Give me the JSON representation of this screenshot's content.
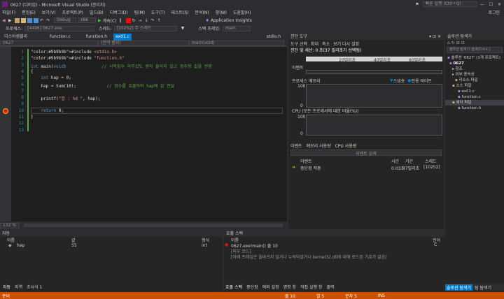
{
  "window": {
    "title": "0627 (디버깅) - Microsoft Visual Studio (관리자)",
    "quick_launch": "빠른 실행 (Ctrl+Q)",
    "login": "로그인"
  },
  "menu": [
    "파일(F)",
    "편집(E)",
    "보기(V)",
    "프로젝트(P)",
    "빌드(B)",
    "디버그(D)",
    "팀(M)",
    "도구(T)",
    "테스트(S)",
    "분석(N)",
    "창(W)",
    "도움말(H)"
  ],
  "toolbar": {
    "config": "Debug",
    "platform": "x86",
    "continue": "계속(C)",
    "app_insights": "Application Insights"
  },
  "debugbar": {
    "process_label": "프로세스:",
    "process": "[4496] 0627.exe",
    "thread_label": "스레드:",
    "thread": "[10252] 주 스레드",
    "frame_label": "스택 프레임:",
    "frame": "main"
  },
  "editor": {
    "tabs": [
      "디스어셈블리",
      "function.c",
      "function.h",
      "ex01.c"
    ],
    "active_tab": "ex01.c",
    "right_tab": "stdio.h",
    "nav_project": "0627",
    "nav_scope": "(전역 범위)",
    "nav_func": "main(void)",
    "zoom": "132 %"
  },
  "code": [
    {
      "n": "1",
      "t": "#include <stdio.h>"
    },
    {
      "n": "2",
      "t": "#include \"function.h\""
    },
    {
      "n": "3",
      "t": "int main(void)              // 시작함수 아무것도 받아 들이지 않고 정수형 값을 반환"
    },
    {
      "n": "4",
      "t": "{"
    },
    {
      "n": "5",
      "t": "    int hap = 0;"
    },
    {
      "n": "6",
      "t": "    hap = Sum(10);            // 함수를 호출하여 hap에 값 전달"
    },
    {
      "n": "7",
      "t": ""
    },
    {
      "n": "8",
      "t": "    printf(\"합 : %d \", hap);"
    },
    {
      "n": "9",
      "t": ""
    },
    {
      "n": "10",
      "t": "    return 0;"
    },
    {
      "n": "11",
      "t": "}"
    },
    {
      "n": "12",
      "t": ""
    },
    {
      "n": "13",
      "t": ""
    }
  ],
  "diag": {
    "title": "진단 도구",
    "session": "진단 및 세션: 0 초(37 밀리초가 선택됨)",
    "ticks": [
      "20밀리초",
      "40밀리초",
      "60밀리초"
    ],
    "events": "이벤트",
    "memory": "프로세스 메모리",
    "snapshot": "스냅숏",
    "private": "전용 바이트",
    "mem_max": "100",
    "mem_min": "0",
    "cpu": "CPU (모든 프로세서에 대한 비율(%))",
    "cpu_max": "100",
    "cpu_min": "0",
    "tabs": [
      "이벤트",
      "메모리 사용량",
      "CPU 사용량"
    ],
    "search": "이벤트 검색",
    "cols": [
      "이벤트",
      "시간",
      "기간",
      "스레드"
    ],
    "row": {
      "event": "중단점 적중",
      "time": "0.03초",
      "duration": "37밀리초",
      "thread": "[10252]"
    },
    "buttons": [
      "도구 선택",
      "확대",
      "축소",
      "보기 다시 설정"
    ]
  },
  "solution": {
    "title": "솔루션 탐색기",
    "search": "솔루션 탐색기 검색(Ctrl+;)",
    "items": [
      "솔루션 '0627' (1개 프로젝트)",
      "0627",
      "참조",
      "외부 종속성",
      "리소스 파일",
      "소스 파일",
      "ex01.c",
      "function.c",
      "헤더 파일",
      "function.h"
    ],
    "bottom_tabs": [
      "솔루션 탐색기",
      "팀 탐색기"
    ]
  },
  "autos": {
    "title": "자동",
    "cols": [
      "이름",
      "값",
      "형식"
    ],
    "row": {
      "name": "hap",
      "value": "55",
      "type": "int"
    },
    "tabs": [
      "자동",
      "지역",
      "조사식 1"
    ]
  },
  "callstack": {
    "title": "호출 스택",
    "cols": [
      "이름",
      "언어"
    ],
    "rows": [
      {
        "name": "0627.exe!main() 줄 10",
        "lang": "C"
      },
      {
        "name": "[외부 코드]",
        "lang": ""
      },
      {
        "name": "[아래 프레임은 올바르지 않거나 누락되었거나 kernel32.dll에 대해 로드된 기호가 없음]",
        "lang": ""
      }
    ],
    "tabs": [
      "호출 스택",
      "중단점",
      "예외 설정",
      "명령 창",
      "직접 실행 창",
      "출력"
    ]
  },
  "status": {
    "left": "준비",
    "line": "줄 10",
    "col": "열 5",
    "ch": "문자 5",
    "mode": "INS"
  },
  "colors": {
    "accent": "#007acc",
    "status": "#ca5100",
    "breakpoint": "#e51400"
  }
}
